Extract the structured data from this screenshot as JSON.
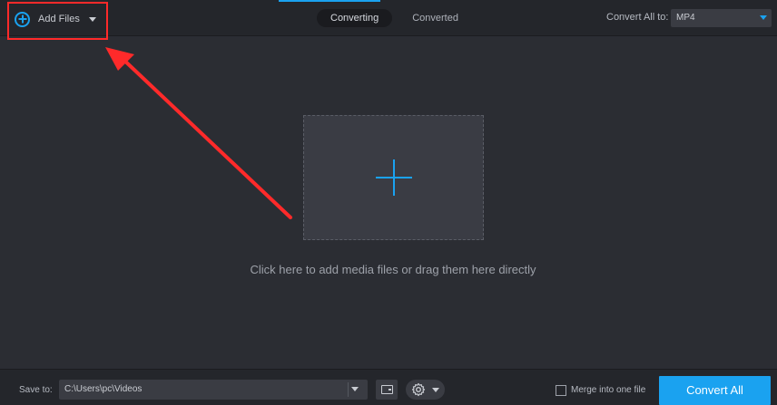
{
  "header": {
    "add_files_label": "Add Files",
    "tabs": [
      {
        "label": "Converting",
        "active": true
      },
      {
        "label": "Converted",
        "active": false
      }
    ],
    "convert_all_to_label": "Convert All to:",
    "format_value": "MP4"
  },
  "main": {
    "drop_hint": "Click here to add media files or drag them here directly"
  },
  "footer": {
    "save_to_label": "Save to:",
    "path_value": "C:\\Users\\pc\\Videos",
    "merge_label": "Merge into one file",
    "merge_checked": false,
    "convert_all_label": "Convert All"
  },
  "colors": {
    "accent": "#1aa2f0",
    "background": "#2b2d33",
    "bar": "#24262b",
    "annotation": "#ff2a2a"
  },
  "icons": [
    "add-circle-icon",
    "chevron-down-icon",
    "plus-icon",
    "folder-icon",
    "gear-icon"
  ]
}
